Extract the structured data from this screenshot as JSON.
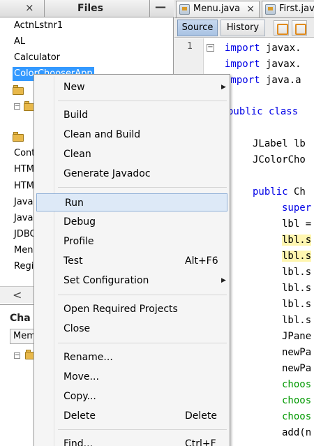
{
  "left_panel": {
    "tab_close": "×",
    "tab_label": "Files",
    "minimize": "—",
    "projects": [
      "ActnLstnr1",
      "AL",
      "Calculator",
      "ColorChooserApp"
    ],
    "partial_items": [
      "Cont",
      "HTM",
      "HTM",
      "Java",
      "Java",
      "JDBC",
      "Men",
      "Regi"
    ],
    "scroll_left": "<"
  },
  "navigator": {
    "tab_label": "Cha",
    "combo_value": "Mem"
  },
  "editor": {
    "tabs": [
      {
        "label": "Menu.java",
        "close": "×"
      },
      {
        "label": "First.jav"
      }
    ],
    "source_label": "Source",
    "history_label": "History",
    "line_number": "1",
    "fold_minus": "−",
    "code_lines": [
      {
        "kw": "import",
        "rest": " javax."
      },
      {
        "kw": "import",
        "rest": " javax."
      },
      {
        "kw": "import",
        "rest": " java.a"
      },
      {
        "kw": "public class",
        "rest": ""
      },
      {
        "kw": "",
        "rest": "JLabel lb"
      },
      {
        "kw": "",
        "rest": "JColorCho"
      },
      {
        "kw": "public",
        "rest": " Ch"
      },
      {
        "kw": "super",
        "rest": ""
      },
      {
        "kw": "",
        "rest": "lbl ="
      },
      {
        "kw": "",
        "rest": "lbl.s"
      },
      {
        "kw": "",
        "rest": "lbl.s"
      },
      {
        "kw": "",
        "rest": "lbl.s"
      },
      {
        "kw": "",
        "rest": "lbl.s"
      },
      {
        "kw": "",
        "rest": "lbl.s"
      },
      {
        "kw": "",
        "rest": "lbl.s"
      },
      {
        "kw": "",
        "rest": "JPane"
      },
      {
        "kw": "",
        "rest": "newPa"
      },
      {
        "kw": "",
        "rest": "newPa"
      },
      {
        "kw": "",
        "rest": "choos"
      },
      {
        "kw": "",
        "rest": "choos"
      },
      {
        "kw": "",
        "rest": "choos"
      },
      {
        "kw": "",
        "rest": "add(n"
      }
    ]
  },
  "context_menu": {
    "items": [
      {
        "label": "New",
        "submenu": true
      },
      {
        "label": "Build"
      },
      {
        "label": "Clean and Build"
      },
      {
        "label": "Clean"
      },
      {
        "label": "Generate Javadoc"
      },
      {
        "label": "Run"
      },
      {
        "label": "Debug"
      },
      {
        "label": "Profile"
      },
      {
        "label": "Test",
        "shortcut": "Alt+F6"
      },
      {
        "label": "Set Configuration",
        "submenu": true
      },
      {
        "label": "Open Required Projects"
      },
      {
        "label": "Close"
      },
      {
        "label": "Rename..."
      },
      {
        "label": "Move..."
      },
      {
        "label": "Copy..."
      },
      {
        "label": "Delete",
        "shortcut": "Delete"
      },
      {
        "label": "Find...",
        "shortcut": "Ctrl+F"
      }
    ],
    "submenu_arrow": "▶"
  },
  "colors": {
    "selection": "#3399ff",
    "menu_hover": "#dde9f7",
    "keyword": "#0000e6",
    "string_green": "#009900"
  }
}
